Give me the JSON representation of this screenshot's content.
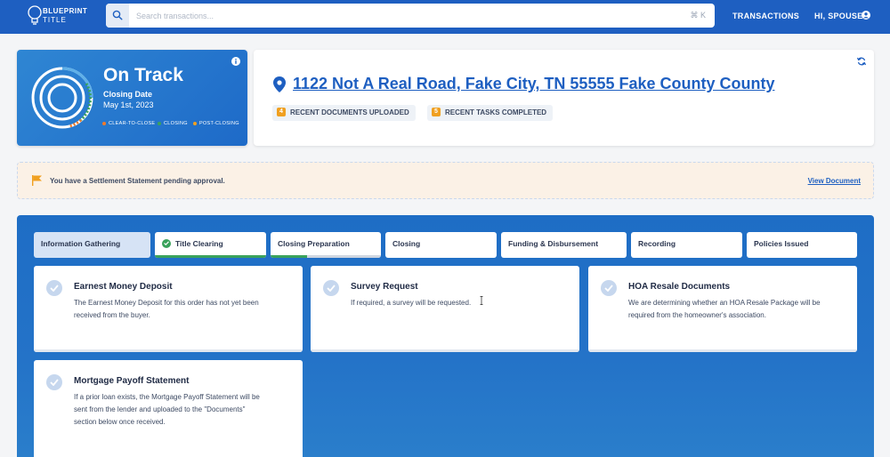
{
  "brand": {
    "name_line1": "BLUEPRINT",
    "name_line2": "TITLE"
  },
  "search": {
    "placeholder": "Search transactions...",
    "shortcut": "⌘ K"
  },
  "nav": {
    "transactions": "TRANSACTIONS",
    "user_greeting": "HI, SPOUSE"
  },
  "status": {
    "title": "On Track",
    "closing_label": "Closing Date",
    "closing_date": "May 1st, 2023",
    "legend": [
      {
        "label": "CLEAR-TO-CLOSE",
        "color": "#f07a2a"
      },
      {
        "label": "CLOSING",
        "color": "#3aa25b"
      },
      {
        "label": "POST-CLOSING",
        "color": "#f0a020"
      }
    ]
  },
  "property": {
    "address": "1122 Not A Real Road, Fake City, TN 55555 Fake County County",
    "recent_documents": {
      "count": "4",
      "label": "RECENT DOCUMENTS UPLOADED"
    },
    "recent_tasks": {
      "count": "5",
      "label": "RECENT TASKS COMPLETED"
    }
  },
  "alert": {
    "message": "You have a Settlement Statement pending approval.",
    "link": "View Document"
  },
  "tabs": [
    {
      "label": "Information Gathering",
      "active": true
    },
    {
      "label": "Title Clearing",
      "complete": true,
      "progress": 1.0
    },
    {
      "label": "Closing Preparation",
      "progress": 0.33
    },
    {
      "label": "Closing"
    },
    {
      "label": "Funding & Disbursement"
    },
    {
      "label": "Recording"
    },
    {
      "label": "Policies Issued"
    }
  ],
  "tasks": [
    {
      "title": "Earnest Money Deposit",
      "body_line1": "The Earnest Money Deposit for this order has not yet been",
      "body_line2": "received from the buyer.",
      "body_line3": ""
    },
    {
      "title": "Survey Request",
      "body_line1": "If required, a survey will be requested.",
      "body_line2": "",
      "body_line3": ""
    },
    {
      "title": "HOA Resale Documents",
      "body_line1": "We are determining whether an HOA Resale Package will be",
      "body_line2": "required from the homeowner's association.",
      "body_line3": ""
    },
    {
      "title": "Mortgage Payoff Statement",
      "body_line1": "If a prior loan exists, the Mortgage Payoff Statement will be",
      "body_line2": "sent from the lender and uploaded to the \"Documents\"",
      "body_line3": "section below once received."
    }
  ],
  "icons": {
    "logo": "lightbulb-icon",
    "search": "search-icon",
    "user": "user-circle-icon",
    "info": "info-icon",
    "pin": "map-pin-icon",
    "refresh": "refresh-icon",
    "flag": "flag-icon",
    "check": "check-circle-icon"
  },
  "colors": {
    "primary": "#1e5fc1",
    "success": "#3aa25b",
    "warning": "#f0a020",
    "alert_bg": "#fbf1e6"
  }
}
